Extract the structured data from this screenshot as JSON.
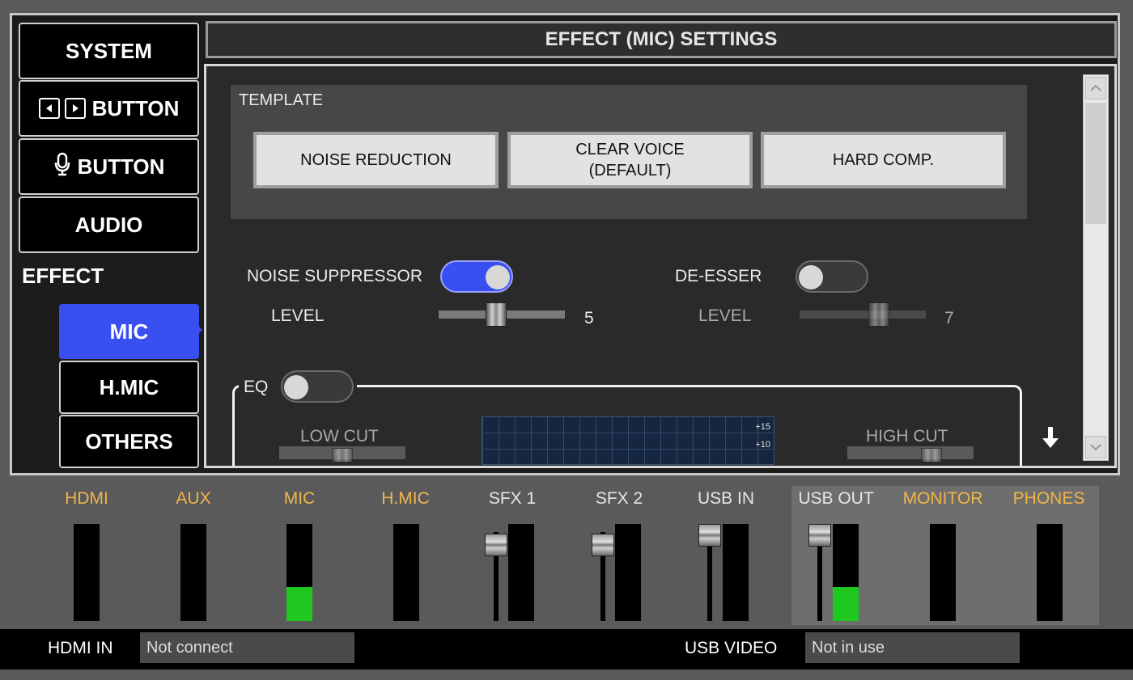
{
  "sidebar": {
    "items": [
      {
        "label": "SYSTEM"
      },
      {
        "label": "BUTTON"
      },
      {
        "label": "BUTTON"
      },
      {
        "label": "AUDIO"
      }
    ],
    "section_label": "EFFECT",
    "sub_items": [
      {
        "label": "MIC",
        "active": true
      },
      {
        "label": "H.MIC",
        "active": false
      },
      {
        "label": "OTHERS",
        "active": false
      }
    ]
  },
  "header": {
    "title": "EFFECT (MIC) SETTINGS"
  },
  "template": {
    "label": "TEMPLATE",
    "buttons": [
      {
        "label": "NOISE REDUCTION"
      },
      {
        "label": "CLEAR VOICE\n(DEFAULT)"
      },
      {
        "label": "HARD COMP."
      }
    ]
  },
  "noise_suppressor": {
    "label": "NOISE SUPPRESSOR",
    "enabled": true,
    "level_label": "LEVEL",
    "level_value": "5"
  },
  "de_esser": {
    "label": "DE-ESSER",
    "enabled": false,
    "level_label": "LEVEL",
    "level_value": "7"
  },
  "eq": {
    "label": "EQ",
    "enabled": false,
    "low_cut_label": "LOW CUT",
    "high_cut_label": "HIGH CUT",
    "graph_ticks": [
      "+15",
      "+10"
    ]
  },
  "mixer": {
    "channels": [
      {
        "label": "HDMI",
        "color": "#f0b54a",
        "level": 0
      },
      {
        "label": "AUX",
        "color": "#f0b54a",
        "level": 0
      },
      {
        "label": "MIC",
        "color": "#f0b54a",
        "level": 0.35
      },
      {
        "label": "H.MIC",
        "color": "#f0b54a",
        "level": 0
      },
      {
        "label": "SFX 1",
        "color": "#e6e6e6",
        "level": 0
      },
      {
        "label": "SFX 2",
        "color": "#e6e6e6",
        "level": 0
      },
      {
        "label": "USB IN",
        "color": "#e6e6e6",
        "level": 0
      },
      {
        "label": "USB OUT",
        "color": "#e6e6e6",
        "level": 0.35
      },
      {
        "label": "MONITOR",
        "color": "#f0b54a",
        "level": 0
      },
      {
        "label": "PHONES",
        "color": "#f0b54a",
        "level": 0
      }
    ]
  },
  "status": {
    "hdmi_in_label": "HDMI IN",
    "hdmi_in_value": "Not connect",
    "usb_video_label": "USB VIDEO",
    "usb_video_value": "Not in use"
  },
  "colors": {
    "accent": "#3a4ff0",
    "meter": "#1ec81e",
    "input_label": "#f0b54a"
  }
}
